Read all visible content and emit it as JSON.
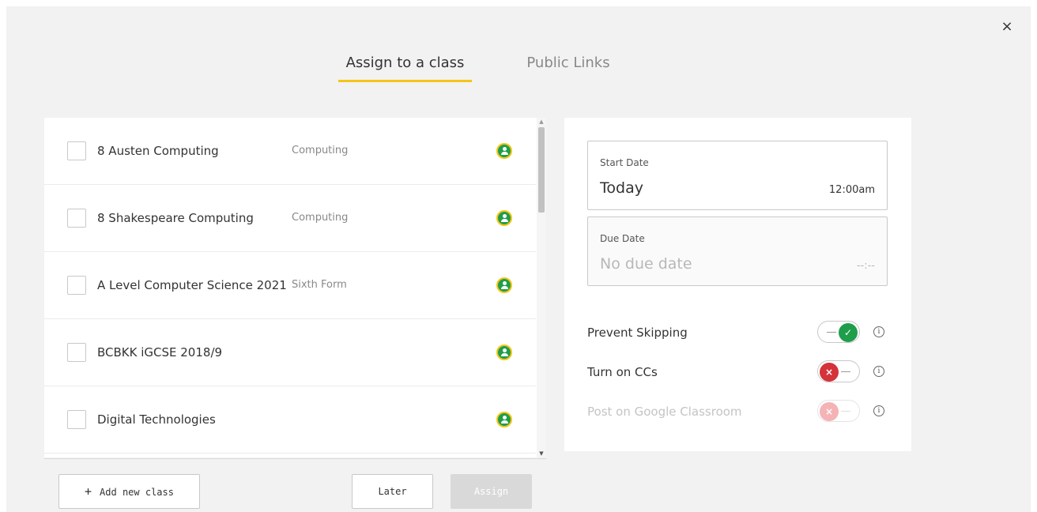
{
  "close_icon": "×",
  "tabs": [
    {
      "label": "Assign to a class",
      "active": true
    },
    {
      "label": "Public Links",
      "active": false
    }
  ],
  "classes": [
    {
      "name": "8 Austen Computing",
      "subject": "Computing",
      "icon": "google-classroom-icon",
      "checked": false
    },
    {
      "name": "8 Shakespeare Computing",
      "subject": "Computing",
      "icon": "google-classroom-icon",
      "checked": false
    },
    {
      "name": "A Level Computer Science 2021",
      "subject": "Sixth Form",
      "icon": "google-classroom-icon",
      "checked": false
    },
    {
      "name": "BCBKK iGCSE 2018/9",
      "subject": "",
      "icon": "google-classroom-icon",
      "checked": false
    },
    {
      "name": "Digital Technologies",
      "subject": "",
      "icon": "google-classroom-icon",
      "checked": false
    }
  ],
  "footer": {
    "add_class_label": "Add new class",
    "add_class_icon": "+",
    "later_label": "Later",
    "assign_label": "Assign"
  },
  "start_date": {
    "label": "Start Date",
    "value": "Today",
    "time": "12:00am"
  },
  "due_date": {
    "label": "Due Date",
    "value": "No due date",
    "time": "--:--"
  },
  "options": [
    {
      "label": "Prevent Skipping",
      "state": "on",
      "knob": "✓",
      "disabled": false
    },
    {
      "label": "Turn on CCs",
      "state": "off",
      "knob": "×",
      "disabled": false
    },
    {
      "label": "Post on Google Classroom",
      "state": "off",
      "knob": "×",
      "disabled": true
    }
  ],
  "info_icon": "i",
  "colors": {
    "accent": "#f5c518",
    "toggle_on": "#1e9e4b",
    "toggle_off": "#d5323a",
    "classroom_green": "#1e9e4b"
  }
}
